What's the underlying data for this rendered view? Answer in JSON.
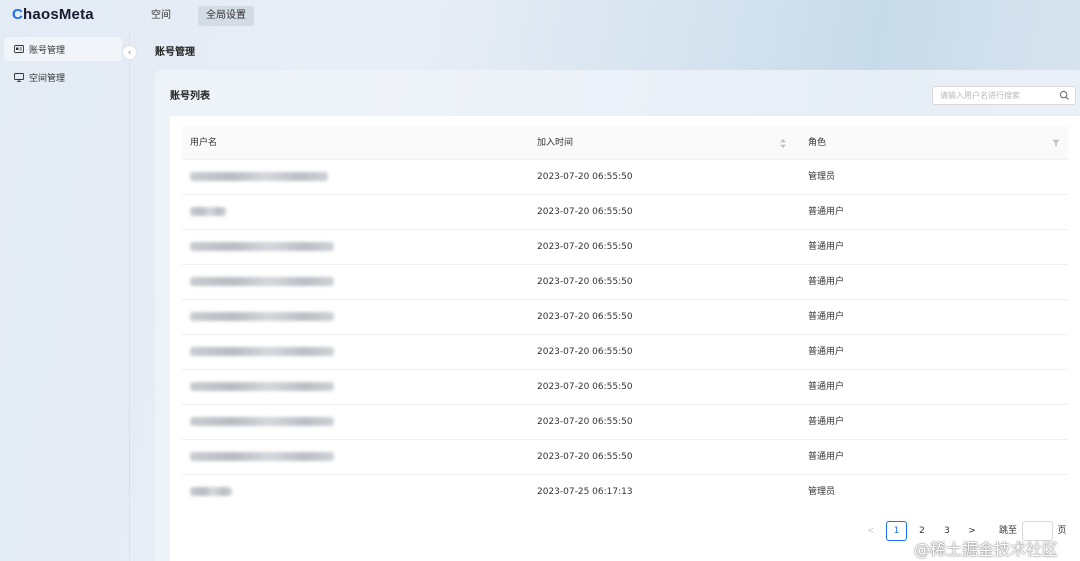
{
  "header": {
    "logo_c": "C",
    "logo_rest": "haosMeta",
    "nav": [
      {
        "label": "空间",
        "active": false
      },
      {
        "label": "全局设置",
        "active": true
      }
    ]
  },
  "sidebar": {
    "items": [
      {
        "label": "账号管理",
        "icon": "id-card-icon",
        "active": true
      },
      {
        "label": "空间管理",
        "icon": "monitor-icon",
        "active": false
      }
    ],
    "collapse_glyph": "‹"
  },
  "page": {
    "title": "账号管理"
  },
  "card": {
    "title": "账号列表",
    "search_placeholder": "请输入用户名进行搜索"
  },
  "table": {
    "columns": [
      "用户名",
      "加入时间",
      "角色"
    ],
    "rows": [
      {
        "time": "2023-07-20 06:55:50",
        "role": "管理员"
      },
      {
        "time": "2023-07-20 06:55:50",
        "role": "普通用户"
      },
      {
        "time": "2023-07-20 06:55:50",
        "role": "普通用户"
      },
      {
        "time": "2023-07-20 06:55:50",
        "role": "普通用户"
      },
      {
        "time": "2023-07-20 06:55:50",
        "role": "普通用户"
      },
      {
        "time": "2023-07-20 06:55:50",
        "role": "普通用户"
      },
      {
        "time": "2023-07-20 06:55:50",
        "role": "普通用户"
      },
      {
        "time": "2023-07-20 06:55:50",
        "role": "普通用户"
      },
      {
        "time": "2023-07-20 06:55:50",
        "role": "普通用户"
      },
      {
        "time": "2023-07-25 06:17:13",
        "role": "管理员"
      }
    ]
  },
  "pagination": {
    "prev": "<",
    "pages": [
      "1",
      "2",
      "3"
    ],
    "current": "1",
    "next": ">",
    "goto_label": "跳至",
    "page_suffix": "页"
  },
  "watermark": "@稀土掘金技术社区",
  "colors": {
    "accent": "#1d6ef2"
  }
}
